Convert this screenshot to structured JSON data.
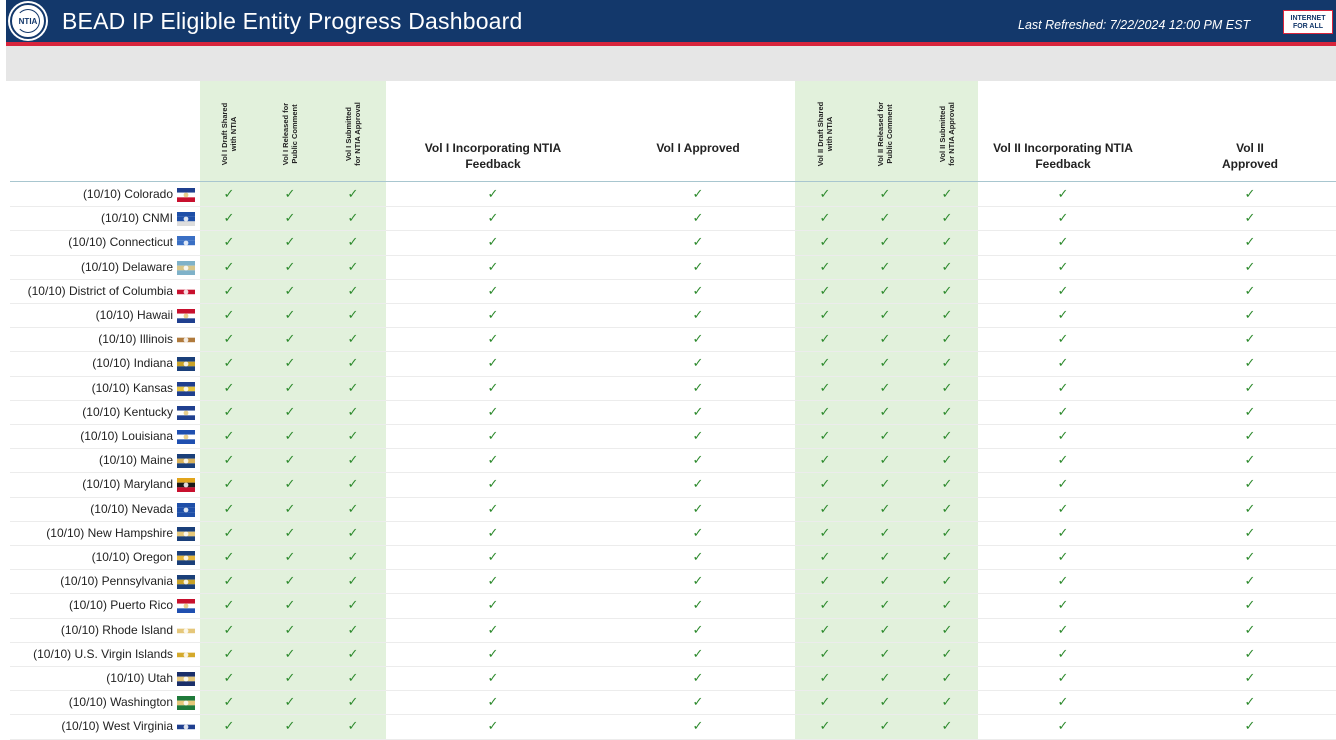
{
  "header": {
    "logo_text": "NTIA",
    "title": "BEAD IP Eligible Entity Progress Dashboard",
    "last_refreshed": "Last Refreshed: 7/22/2024 12:00 PM EST",
    "badge_line1": "INTERNET",
    "badge_line2": "FOR ALL"
  },
  "columns": [
    {
      "label": "Vol I Draft Shared\nwith NTIA",
      "style": "rot"
    },
    {
      "label": "Vol I Released for\nPublic Comment",
      "style": "rot"
    },
    {
      "label": "Vol I Submitted\nfor NTIA Approval",
      "style": "rot"
    },
    {
      "label": "Vol I Incorporating NTIA\nFeedback",
      "style": "wide"
    },
    {
      "label": "Vol I Approved",
      "style": "wide"
    },
    {
      "label": "Vol II Draft Shared\nwith NTIA",
      "style": "rot"
    },
    {
      "label": "Vol II Released for\nPublic Comment",
      "style": "rot"
    },
    {
      "label": "Vol II Submitted\nfor NTIA Approval",
      "style": "rot"
    },
    {
      "label": "Vol II Incorporating NTIA\nFeedback",
      "style": "wide"
    },
    {
      "label": "Vol II Approved",
      "style": "wide"
    }
  ],
  "check_glyph": "✓",
  "colors": {
    "header": "#13386b",
    "accent_red": "#d8253c",
    "check": "#2d8a2d",
    "highlight": "#e2f1dc"
  },
  "rows": [
    {
      "label": "(10/10) Colorado",
      "flag": "colorado-flag-icon"
    },
    {
      "label": "(10/10) CNMI",
      "flag": "cnmi-flag-icon"
    },
    {
      "label": "(10/10) Connecticut",
      "flag": "connecticut-flag-icon"
    },
    {
      "label": "(10/10) Delaware",
      "flag": "delaware-flag-icon"
    },
    {
      "label": "(10/10) District of Columbia",
      "flag": "dc-flag-icon"
    },
    {
      "label": "(10/10) Hawaii",
      "flag": "hawaii-flag-icon"
    },
    {
      "label": "(10/10) Illinois",
      "flag": "illinois-flag-icon"
    },
    {
      "label": "(10/10) Indiana",
      "flag": "indiana-flag-icon"
    },
    {
      "label": "(10/10) Kansas",
      "flag": "kansas-flag-icon"
    },
    {
      "label": "(10/10) Kentucky",
      "flag": "kentucky-flag-icon"
    },
    {
      "label": "(10/10) Louisiana",
      "flag": "louisiana-flag-icon"
    },
    {
      "label": "(10/10) Maine",
      "flag": "maine-flag-icon"
    },
    {
      "label": "(10/10) Maryland",
      "flag": "maryland-flag-icon"
    },
    {
      "label": "(10/10) Nevada",
      "flag": "nevada-flag-icon"
    },
    {
      "label": "(10/10) New Hampshire",
      "flag": "new-hampshire-flag-icon"
    },
    {
      "label": "(10/10) Oregon",
      "flag": "oregon-flag-icon"
    },
    {
      "label": "(10/10) Pennsylvania",
      "flag": "pennsylvania-flag-icon"
    },
    {
      "label": "(10/10) Puerto Rico",
      "flag": "puerto-rico-flag-icon"
    },
    {
      "label": "(10/10) Rhode Island",
      "flag": "rhode-island-flag-icon"
    },
    {
      "label": "(10/10) U.S. Virgin Islands",
      "flag": "usvi-flag-icon"
    },
    {
      "label": "(10/10) Utah",
      "flag": "utah-flag-icon"
    },
    {
      "label": "(10/10) Washington",
      "flag": "washington-flag-icon"
    },
    {
      "label": "(10/10) West Virginia",
      "flag": "west-virginia-flag-icon"
    }
  ]
}
